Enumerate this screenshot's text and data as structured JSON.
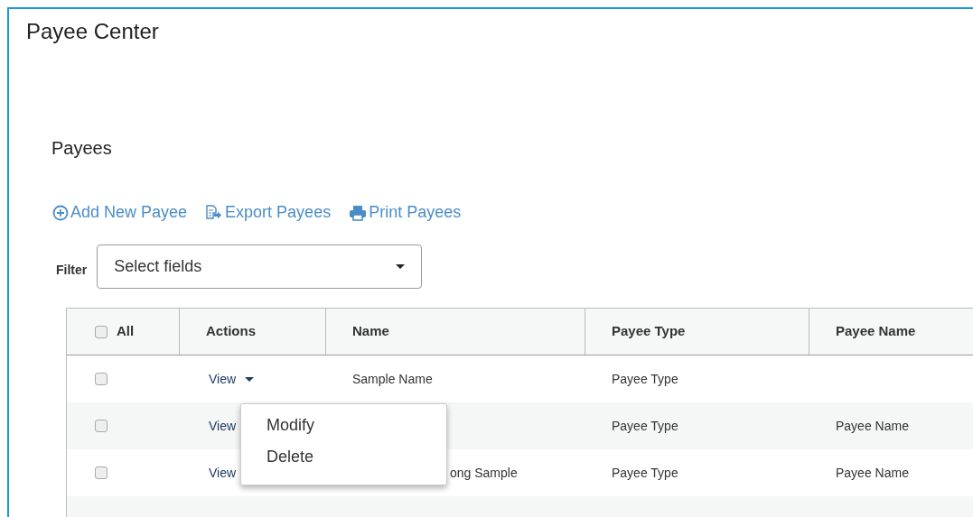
{
  "page": {
    "title": "Payee Center"
  },
  "section": {
    "title": "Payees"
  },
  "actions": [
    {
      "kind": "add",
      "label": "Add New Payee"
    },
    {
      "kind": "export",
      "label": "Export Payees"
    },
    {
      "kind": "print",
      "label": "Print Payees"
    }
  ],
  "filter": {
    "label": "Filter",
    "placeholder": "Select fields"
  },
  "table": {
    "select_all": {
      "label": "All",
      "checked": false
    },
    "columns": [
      "Actions",
      "Name",
      "Payee Type",
      "Payee Name"
    ],
    "rows": [
      {
        "checked": false,
        "action": "View",
        "caret": true,
        "name": "Sample Name",
        "name_covered": false,
        "payee_type": "Payee Type"
      },
      {
        "checked": false,
        "action": "View",
        "caret": false,
        "payee_type": "Payee Type",
        "payee_name": "Payee Name"
      },
      {
        "checked": false,
        "action": "View",
        "caret": false,
        "name": "ong Sample",
        "name_covered": true,
        "payee_type": "Payee Type",
        "payee_name": "Payee Name"
      }
    ]
  },
  "row_menu": {
    "items": [
      "Modify",
      "Delete"
    ]
  }
}
